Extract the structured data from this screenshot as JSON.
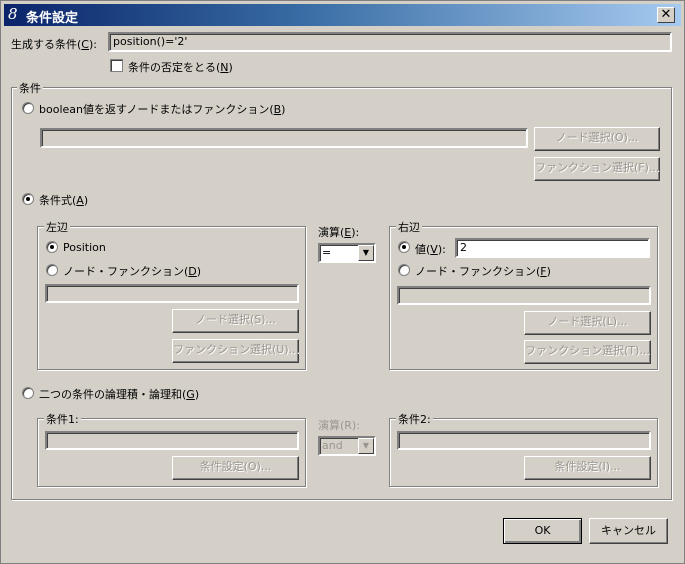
{
  "window": {
    "title": "条件設定",
    "close_label": "✕"
  },
  "generated": {
    "label": "生成する条件(",
    "mnemonic": "C",
    "label_end": "):",
    "value": "position()='2'"
  },
  "negate": {
    "label": "条件の否定をとる(",
    "mnemonic": "N",
    "label_end": ")",
    "checked": false
  },
  "conditions_group": {
    "legend": "条件"
  },
  "boolean_option": {
    "label": "boolean値を返すノードまたはファンクション(",
    "mnemonic": "B",
    "label_end": ")",
    "selected": false,
    "field_value": "",
    "node_button": "ノード選択(O)...",
    "function_button": "ファンクション選択(F)..."
  },
  "expression_option": {
    "label": "条件式(",
    "mnemonic": "A",
    "label_end": ")",
    "selected": true
  },
  "left_side": {
    "legend": "左辺",
    "position_label": "Position",
    "position_selected": true,
    "node_function_label": "ノード・ファンクション(",
    "node_function_mnemonic": "D",
    "node_function_label_end": ")",
    "node_function_selected": false,
    "field_value": "",
    "node_button": "ノード選択(S)...",
    "function_button": "ファンクション選択(U)..."
  },
  "operator": {
    "label": "演算(",
    "mnemonic": "E",
    "label_end": "):",
    "value": "="
  },
  "right_side": {
    "legend": "右辺",
    "value_label": "値(",
    "value_mnemonic": "V",
    "value_label_end": "):",
    "value_selected": true,
    "value": "2",
    "node_function_label": "ノード・ファンクション(",
    "node_function_mnemonic": "F",
    "node_function_label_end": ")",
    "node_function_selected": false,
    "field_value": "",
    "node_button": "ノード選択(L)...",
    "function_button": "ファンクション選択(T)..."
  },
  "logical_option": {
    "label": "二つの条件の論理積・論理和(",
    "mnemonic": "G",
    "label_end": ")",
    "selected": false
  },
  "condition1": {
    "legend": "条件1:",
    "field_value": "",
    "button": "条件設定(O)..."
  },
  "logical_operator": {
    "label": "演算(R):",
    "value": "and"
  },
  "condition2": {
    "legend": "条件2:",
    "field_value": "",
    "button": "条件設定(I)..."
  },
  "footer": {
    "ok": "OK",
    "cancel": "キャンセル"
  }
}
